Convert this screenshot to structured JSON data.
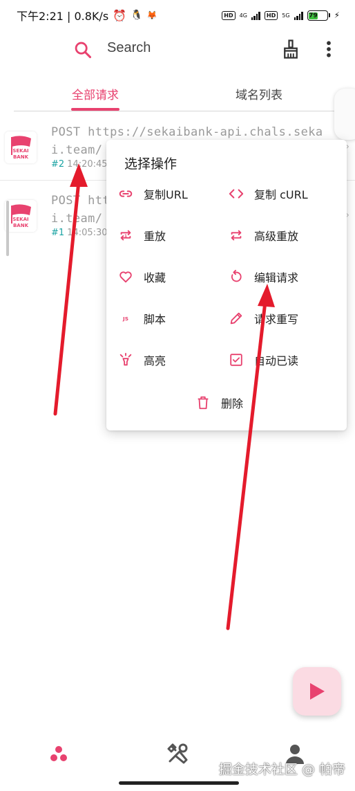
{
  "status_bar": {
    "time_speed": "下午2:21 | 0.8K/s",
    "hd1": "HD",
    "net1": "4G",
    "hd2": "HD",
    "net2": "5G",
    "battery": "79"
  },
  "search": {
    "label": "Search"
  },
  "tabs": [
    {
      "label": "全部请求",
      "active": true
    },
    {
      "label": "域名列表",
      "active": false
    }
  ],
  "requests": [
    {
      "url": "POST https://sekaibank-api.chals.sekai.team/",
      "number": "#2",
      "time": "14:20:45",
      "logo_text": "SEKAI BANK"
    },
    {
      "url": "POST https://sekaibank-api.chals.sekai.team/",
      "number": "#1",
      "time": "14:05:30",
      "logo_text": "SEKAI BANK"
    }
  ],
  "dialog": {
    "title": "选择操作",
    "actions": [
      {
        "label": "复制URL",
        "icon": "link-icon"
      },
      {
        "label": "复制 cURL",
        "icon": "code-icon"
      },
      {
        "label": "重放",
        "icon": "replay-icon"
      },
      {
        "label": "高级重放",
        "icon": "repeat-icon"
      },
      {
        "label": "收藏",
        "icon": "heart-icon"
      },
      {
        "label": "编辑请求",
        "icon": "edit-request-icon"
      },
      {
        "label": "脚本",
        "icon": "js-icon"
      },
      {
        "label": "请求重写",
        "icon": "pencil-icon"
      },
      {
        "label": "高亮",
        "icon": "lightbulb-icon"
      },
      {
        "label": "自动已读",
        "icon": "checkbox-icon"
      }
    ],
    "delete_label": "删除"
  },
  "watermark": "掘金技术社区 @ 帕帝",
  "colors": {
    "accent": "#e8426f",
    "teal": "#1aa3a3",
    "annotation": "#e41b2c"
  }
}
